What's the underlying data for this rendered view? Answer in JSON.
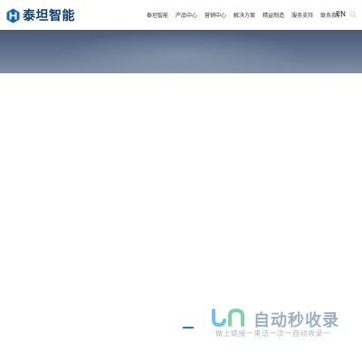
{
  "brand": {
    "name": "泰坦智能",
    "logo_icon": "titan-logo-icon",
    "color": "#0d3c6e"
  },
  "nav": {
    "items": [
      {
        "label": "泰坦智能"
      },
      {
        "label": "产品中心"
      },
      {
        "label": "营销中心"
      },
      {
        "label": "解决方案"
      },
      {
        "label": "精益制造"
      },
      {
        "label": "服务支持"
      },
      {
        "label": "联系我们"
      }
    ]
  },
  "header": {
    "lang_label": "EN",
    "search_icon": "search-icon"
  },
  "hero": {
    "slide_indicator_color": "#1e7fd1"
  },
  "watermark": {
    "title": "自动秒收录",
    "subtitle": "做上链接一来访一次一自动收录一"
  }
}
